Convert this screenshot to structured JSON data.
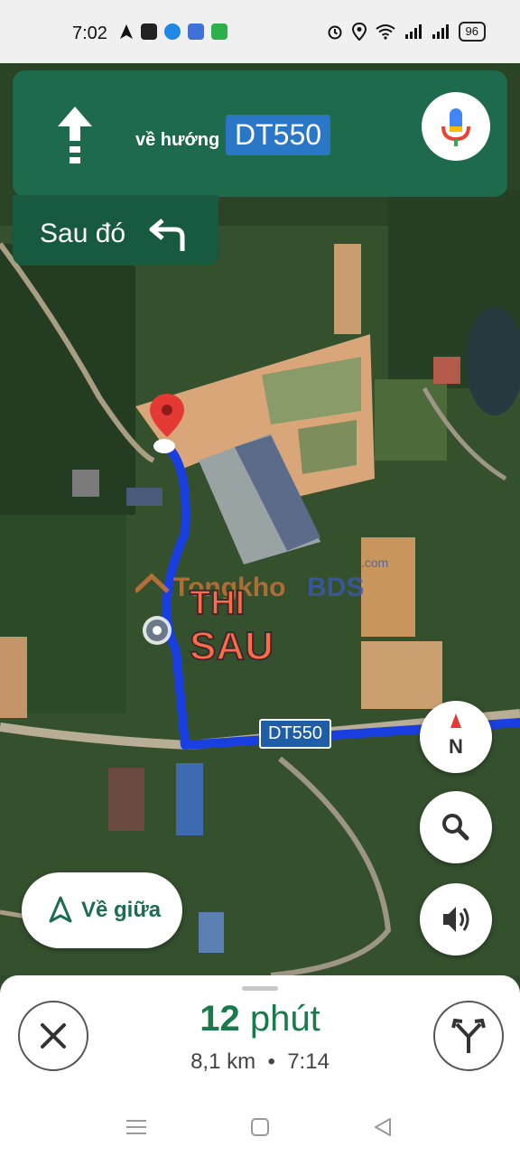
{
  "status_bar": {
    "time": "7:02",
    "battery": "96",
    "left_icons": [
      "navigation-arrow-icon",
      "app-h-icon",
      "app-blue-icon",
      "app-mail-icon",
      "app-green-icon"
    ],
    "right_icons": [
      "alarm-icon",
      "location-icon",
      "wifi-icon",
      "signal-icon",
      "signal-icon",
      "battery-icon"
    ]
  },
  "navigation": {
    "maneuver_icon": "arrow-straight-icon",
    "toward_label": "về hướng",
    "road_name": "DT550",
    "then_label": "Sau đó",
    "then_icon": "turn-left-icon",
    "mic_icon": "microphone-icon"
  },
  "map": {
    "road_label": "DT550",
    "watermark": "TongkhoBDS .com THI SAU",
    "compass_label": "N",
    "recenter_label": "Về giữa",
    "route_color": "#1a3fe0"
  },
  "trip": {
    "eta_value": "12",
    "eta_unit": "phút",
    "distance": "8,1 km",
    "separator": "•",
    "arrival_time": "7:14"
  },
  "colors": {
    "nav_banner": "#1e6a4c",
    "then_banner": "#175a40",
    "road_pill": "#2b77c7",
    "eta_green": "#1b7a4a"
  }
}
